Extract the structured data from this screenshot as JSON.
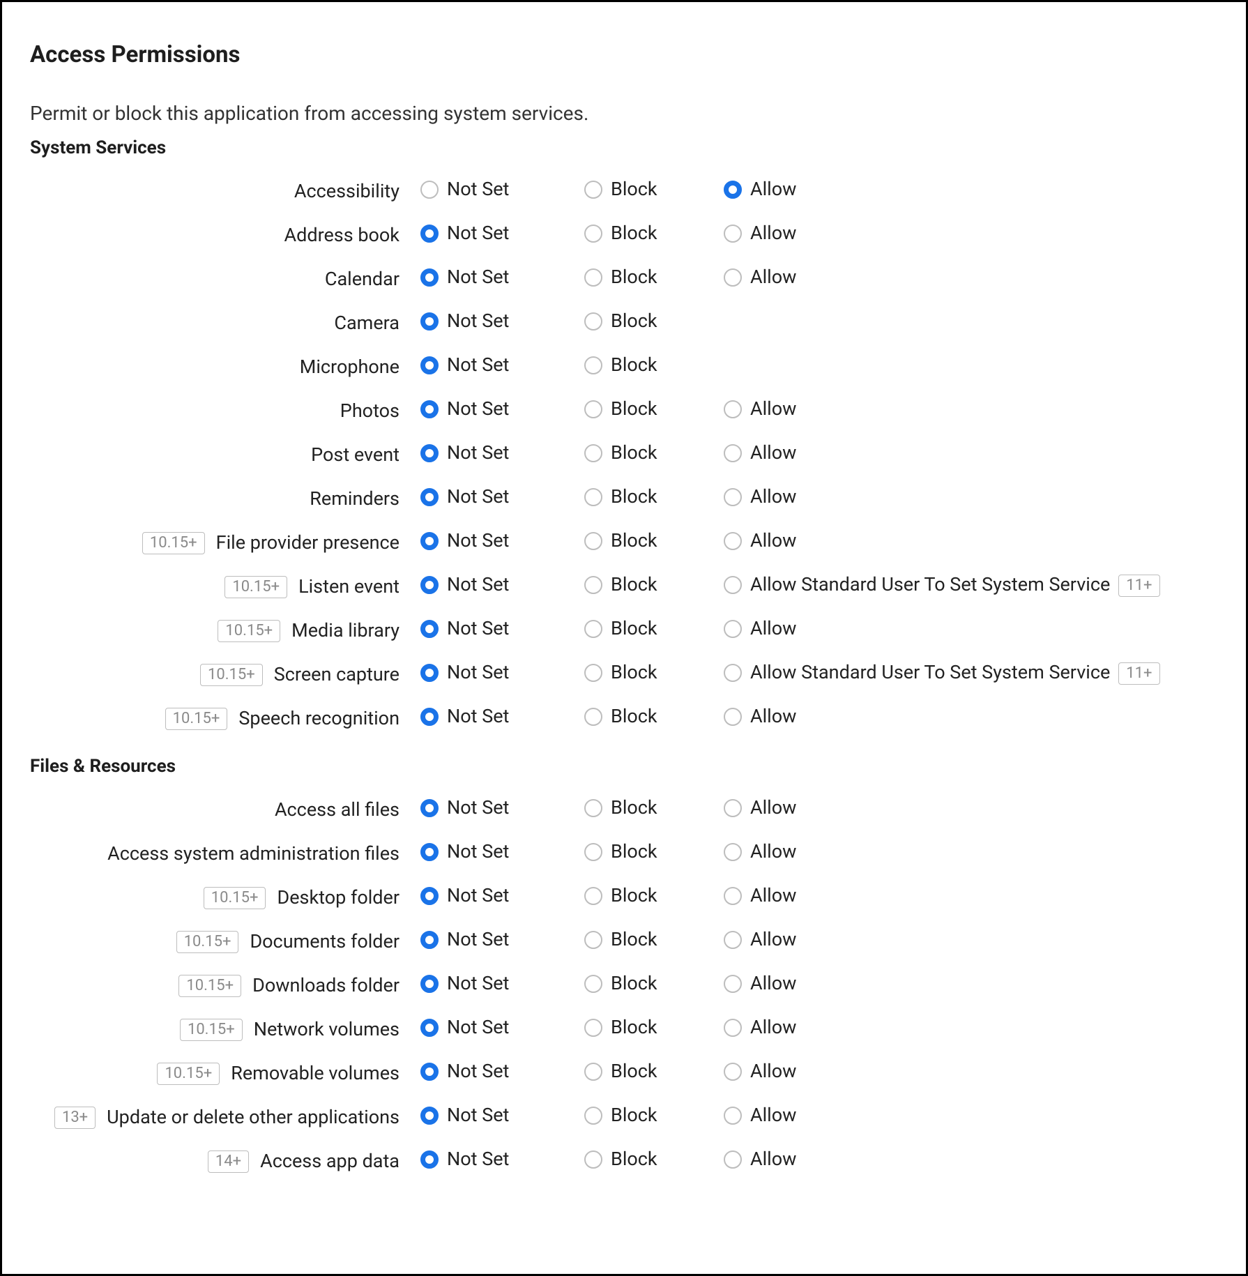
{
  "title": "Access Permissions",
  "description": "Permit or block this application from accessing system services.",
  "option_labels": {
    "not_set": "Not Set",
    "block": "Block",
    "allow": "Allow",
    "allow_standard": "Allow Standard User To Set System Service"
  },
  "sections": [
    {
      "id": "system-services",
      "heading": "System Services",
      "items": [
        {
          "id": "accessibility",
          "label": "Accessibility",
          "badge": null,
          "selected": "allow",
          "has_allow": true,
          "allow_label_key": "allow",
          "trailing_badge": null
        },
        {
          "id": "address-book",
          "label": "Address book",
          "badge": null,
          "selected": "not_set",
          "has_allow": true,
          "allow_label_key": "allow",
          "trailing_badge": null
        },
        {
          "id": "calendar",
          "label": "Calendar",
          "badge": null,
          "selected": "not_set",
          "has_allow": true,
          "allow_label_key": "allow",
          "trailing_badge": null
        },
        {
          "id": "camera",
          "label": "Camera",
          "badge": null,
          "selected": "not_set",
          "has_allow": false,
          "allow_label_key": null,
          "trailing_badge": null
        },
        {
          "id": "microphone",
          "label": "Microphone",
          "badge": null,
          "selected": "not_set",
          "has_allow": false,
          "allow_label_key": null,
          "trailing_badge": null
        },
        {
          "id": "photos",
          "label": "Photos",
          "badge": null,
          "selected": "not_set",
          "has_allow": true,
          "allow_label_key": "allow",
          "trailing_badge": null
        },
        {
          "id": "post-event",
          "label": "Post event",
          "badge": null,
          "selected": "not_set",
          "has_allow": true,
          "allow_label_key": "allow",
          "trailing_badge": null
        },
        {
          "id": "reminders",
          "label": "Reminders",
          "badge": null,
          "selected": "not_set",
          "has_allow": true,
          "allow_label_key": "allow",
          "trailing_badge": null
        },
        {
          "id": "file-provider-presence",
          "label": "File provider presence",
          "badge": "10.15+",
          "selected": "not_set",
          "has_allow": true,
          "allow_label_key": "allow",
          "trailing_badge": null
        },
        {
          "id": "listen-event",
          "label": "Listen event",
          "badge": "10.15+",
          "selected": "not_set",
          "has_allow": true,
          "allow_label_key": "allow_standard",
          "trailing_badge": "11+"
        },
        {
          "id": "media-library",
          "label": "Media library",
          "badge": "10.15+",
          "selected": "not_set",
          "has_allow": true,
          "allow_label_key": "allow",
          "trailing_badge": null
        },
        {
          "id": "screen-capture",
          "label": "Screen capture",
          "badge": "10.15+",
          "selected": "not_set",
          "has_allow": true,
          "allow_label_key": "allow_standard",
          "trailing_badge": "11+"
        },
        {
          "id": "speech-recognition",
          "label": "Speech recognition",
          "badge": "10.15+",
          "selected": "not_set",
          "has_allow": true,
          "allow_label_key": "allow",
          "trailing_badge": null
        }
      ]
    },
    {
      "id": "files-resources",
      "heading": "Files & Resources",
      "items": [
        {
          "id": "access-all-files",
          "label": "Access all files",
          "badge": null,
          "selected": "not_set",
          "has_allow": true,
          "allow_label_key": "allow",
          "trailing_badge": null
        },
        {
          "id": "access-system-admin-files",
          "label": "Access system administration files",
          "badge": null,
          "selected": "not_set",
          "has_allow": true,
          "allow_label_key": "allow",
          "trailing_badge": null
        },
        {
          "id": "desktop-folder",
          "label": "Desktop folder",
          "badge": "10.15+",
          "selected": "not_set",
          "has_allow": true,
          "allow_label_key": "allow",
          "trailing_badge": null
        },
        {
          "id": "documents-folder",
          "label": "Documents folder",
          "badge": "10.15+",
          "selected": "not_set",
          "has_allow": true,
          "allow_label_key": "allow",
          "trailing_badge": null
        },
        {
          "id": "downloads-folder",
          "label": "Downloads folder",
          "badge": "10.15+",
          "selected": "not_set",
          "has_allow": true,
          "allow_label_key": "allow",
          "trailing_badge": null
        },
        {
          "id": "network-volumes",
          "label": "Network volumes",
          "badge": "10.15+",
          "selected": "not_set",
          "has_allow": true,
          "allow_label_key": "allow",
          "trailing_badge": null
        },
        {
          "id": "removable-volumes",
          "label": "Removable volumes",
          "badge": "10.15+",
          "selected": "not_set",
          "has_allow": true,
          "allow_label_key": "allow",
          "trailing_badge": null
        },
        {
          "id": "update-delete-other-apps",
          "label": "Update or delete other applications",
          "badge": "13+",
          "selected": "not_set",
          "has_allow": true,
          "allow_label_key": "allow",
          "trailing_badge": null
        },
        {
          "id": "access-app-data",
          "label": "Access app data",
          "badge": "14+",
          "selected": "not_set",
          "has_allow": true,
          "allow_label_key": "allow",
          "trailing_badge": null
        }
      ]
    }
  ]
}
